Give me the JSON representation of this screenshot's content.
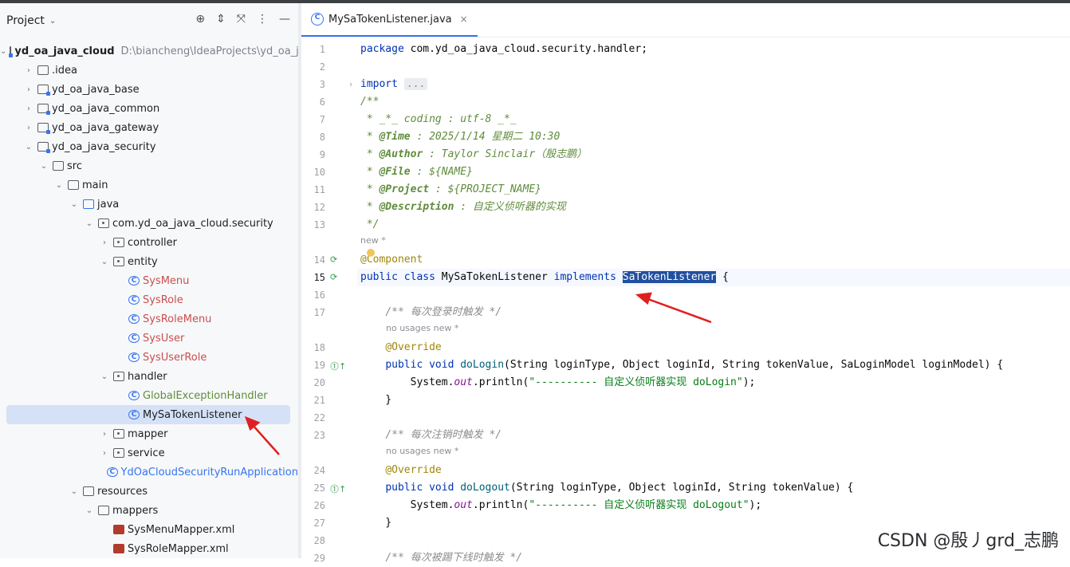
{
  "project_panel": {
    "title": "Project",
    "tree": [
      {
        "label": "yd_oa_java_cloud",
        "path": "D:\\biancheng\\IdeaProjects\\yd_oa_j",
        "indent": 0,
        "arrow": "down",
        "icon": "modfolder",
        "bold": true
      },
      {
        "label": ".idea",
        "indent": 1,
        "arrow": "right",
        "icon": "folder"
      },
      {
        "label": "yd_oa_java_base",
        "indent": 1,
        "arrow": "right",
        "icon": "modfolder",
        "bold": false
      },
      {
        "label": "yd_oa_java_common",
        "indent": 1,
        "arrow": "right",
        "icon": "modfolder"
      },
      {
        "label": "yd_oa_java_gateway",
        "indent": 1,
        "arrow": "right",
        "icon": "modfolder"
      },
      {
        "label": "yd_oa_java_security",
        "indent": 1,
        "arrow": "down",
        "icon": "modfolder"
      },
      {
        "label": "src",
        "indent": 2,
        "arrow": "down",
        "icon": "folder"
      },
      {
        "label": "main",
        "indent": 3,
        "arrow": "down",
        "icon": "folder"
      },
      {
        "label": "java",
        "indent": 4,
        "arrow": "down",
        "icon": "folder-blue"
      },
      {
        "label": "com.yd_oa_java_cloud.security",
        "indent": 5,
        "arrow": "down",
        "icon": "pkg"
      },
      {
        "label": "controller",
        "indent": 6,
        "arrow": "right",
        "icon": "pkg"
      },
      {
        "label": "entity",
        "indent": 6,
        "arrow": "down",
        "icon": "pkg"
      },
      {
        "label": "SysMenu",
        "indent": 7,
        "arrow": "",
        "icon": "class",
        "color": "red"
      },
      {
        "label": "SysRole",
        "indent": 7,
        "arrow": "",
        "icon": "class",
        "color": "red"
      },
      {
        "label": "SysRoleMenu",
        "indent": 7,
        "arrow": "",
        "icon": "class",
        "color": "red"
      },
      {
        "label": "SysUser",
        "indent": 7,
        "arrow": "",
        "icon": "class",
        "color": "red"
      },
      {
        "label": "SysUserRole",
        "indent": 7,
        "arrow": "",
        "icon": "class",
        "color": "red"
      },
      {
        "label": "handler",
        "indent": 6,
        "arrow": "down",
        "icon": "pkg"
      },
      {
        "label": "GlobalExceptionHandler",
        "indent": 7,
        "arrow": "",
        "icon": "class",
        "color": "green"
      },
      {
        "label": "MySaTokenListener",
        "indent": 7,
        "arrow": "",
        "icon": "class",
        "selected": true
      },
      {
        "label": "mapper",
        "indent": 6,
        "arrow": "right",
        "icon": "pkg"
      },
      {
        "label": "service",
        "indent": 6,
        "arrow": "right",
        "icon": "pkg"
      },
      {
        "label": "YdOaCloudSecurityRunApplication",
        "indent": 6,
        "arrow": "",
        "icon": "class",
        "color": "blue"
      },
      {
        "label": "resources",
        "indent": 4,
        "arrow": "down",
        "icon": "folder"
      },
      {
        "label": "mappers",
        "indent": 5,
        "arrow": "down",
        "icon": "folder"
      },
      {
        "label": "SysMenuMapper.xml",
        "indent": 6,
        "arrow": "",
        "icon": "xml"
      },
      {
        "label": "SysRoleMapper.xml",
        "indent": 6,
        "arrow": "",
        "icon": "xml"
      }
    ]
  },
  "editor": {
    "tab_label": "MySaTokenListener.java",
    "tab_close": "×",
    "lines": [
      {
        "n": "1",
        "html": "<span class='kw'>package</span> com.yd_oa_java_cloud.security.handler;"
      },
      {
        "n": "2",
        "html": ""
      },
      {
        "n": "3",
        "html": "<span class='kw'>import</span> <span class='fold-box'>...</span>",
        "fold": "›"
      },
      {
        "n": "6",
        "html": "<span class='doc'>/**</span>"
      },
      {
        "n": "7",
        "html": "<span class='doc'> * _*_ coding : utf-8 _*_</span>"
      },
      {
        "n": "8",
        "html": "<span class='doc'> * <b>@Time</b> : 2025/1/14 星期二 10:30</span>"
      },
      {
        "n": "9",
        "html": "<span class='doc'> * <b>@Author</b> : Taylor Sinclair（殷志鹏）</span>"
      },
      {
        "n": "10",
        "html": "<span class='doc'> * <b>@File</b> : ${NAME}</span>"
      },
      {
        "n": "11",
        "html": "<span class='doc'> * <b>@Project</b> : ${PROJECT_NAME}</span>"
      },
      {
        "n": "12",
        "html": "<span class='doc'> * <b>@Description</b> : 自定义侦听器的实现</span>"
      },
      {
        "n": "13",
        "html": "<span class='doc'> */</span>"
      },
      {
        "n": "",
        "hint": "new *"
      },
      {
        "n": "14",
        "html": "<span class='ann'>@Component</span>",
        "gicon": "⟳"
      },
      {
        "n": "15",
        "html": "<span class='kw'>public class</span> MySaTokenListener <span class='kw'>implements</span> <span class='sel'>SaTokenListener</span> {",
        "gicon": "⟳",
        "current": true
      },
      {
        "n": "16",
        "html": ""
      },
      {
        "n": "17",
        "html": "    <span class='cm'>/** 每次登录时触发 */</span>"
      },
      {
        "n": "",
        "hint": "no usages   new *"
      },
      {
        "n": "18",
        "html": "    <span class='ann'>@Override</span>"
      },
      {
        "n": "19",
        "html": "    <span class='kw'>public void</span> <span class='mth'>doLogin</span>(String loginType, Object loginId, String tokenValue, SaLoginModel loginModel) {",
        "gicon": "⓵↑"
      },
      {
        "n": "20",
        "html": "        System.<span class='fld'>out</span>.println(<span class='str'>\"---------- 自定义侦听器实现 doLogin\"</span>);"
      },
      {
        "n": "21",
        "html": "    }"
      },
      {
        "n": "22",
        "html": ""
      },
      {
        "n": "23",
        "html": "    <span class='cm'>/** 每次注销时触发 */</span>"
      },
      {
        "n": "",
        "hint": "no usages   new *"
      },
      {
        "n": "24",
        "html": "    <span class='ann'>@Override</span>"
      },
      {
        "n": "25",
        "html": "    <span class='kw'>public void</span> <span class='mth'>doLogout</span>(String loginType, Object loginId, String tokenValue) {",
        "gicon": "⓵↑"
      },
      {
        "n": "26",
        "html": "        System.<span class='fld'>out</span>.println(<span class='str'>\"---------- 自定义侦听器实现 doLogout\"</span>);"
      },
      {
        "n": "27",
        "html": "    }"
      },
      {
        "n": "28",
        "html": ""
      },
      {
        "n": "29",
        "html": "    <span class='cm'>/** 每次被踢下线时触发 */</span>"
      }
    ]
  },
  "watermark": "CSDN @殷丿grd_志鹏"
}
